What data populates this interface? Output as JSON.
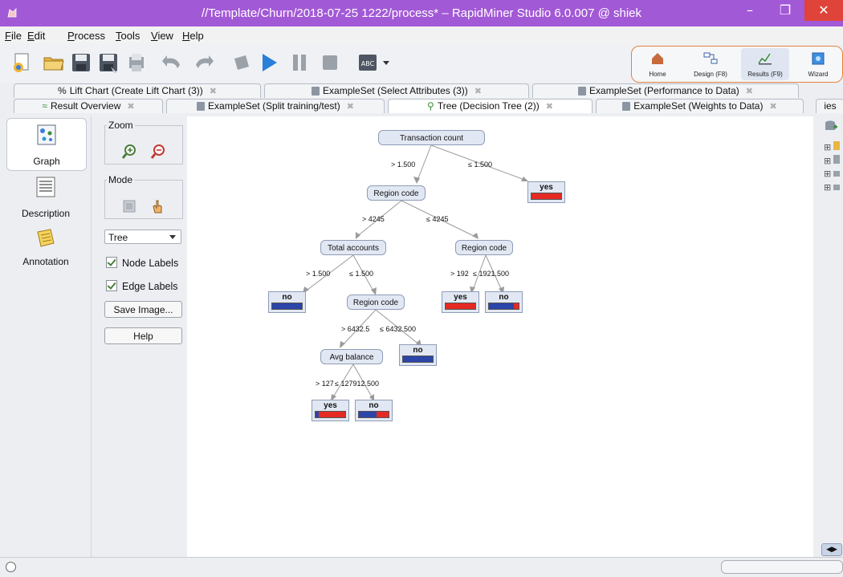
{
  "window": {
    "title": "//Template/Churn/2018-07-25 1222/process* – RapidMiner Studio 6.0.007 @ shiek"
  },
  "menu": [
    {
      "underline": "F",
      "rest": "ile"
    },
    {
      "underline": "E",
      "rest": "dit"
    },
    {
      "underline": "P",
      "rest": "rocess"
    },
    {
      "underline": "T",
      "rest": "ools"
    },
    {
      "underline": "V",
      "rest": "iew"
    },
    {
      "underline": "H",
      "rest": "elp"
    }
  ],
  "perspectives": {
    "home": "Home",
    "design": "Design (F8)",
    "results": "Results (F9)",
    "wizard": "Wizard"
  },
  "tabs_top": [
    {
      "label": "Lift Chart (Create Lift Chart (3))"
    },
    {
      "label": "ExampleSet (Select Attributes (3))"
    },
    {
      "label": "ExampleSet (Performance to Data)"
    }
  ],
  "tabs_bottom": [
    {
      "label": "Result Overview"
    },
    {
      "label": "ExampleSet (Split training/test)"
    },
    {
      "label": "Tree (Decision Tree (2))"
    },
    {
      "label": "ExampleSet (Weights to Data)"
    }
  ],
  "right_tab_label": "ies",
  "views": {
    "graph": "Graph",
    "description": "Description",
    "annotation": "Annotation"
  },
  "tools": {
    "zoom_label": "Zoom",
    "mode_label": "Mode",
    "layout_value": "Tree",
    "node_labels": "Node Labels",
    "edge_labels": "Edge Labels",
    "save_image": "Save Image...",
    "help": "Help"
  },
  "tree": {
    "nodes": {
      "root": "Transaction count",
      "region1": "Region code",
      "total_accounts": "Total accounts",
      "region2": "Region code",
      "region3": "Region code",
      "avg_balance": "Avg balance"
    },
    "edges": {
      "e1": "> 1.500",
      "e2": "≤ 1.500",
      "e3": "> 4245",
      "e4": "≤ 4245",
      "e5": "> 1.500",
      "e6": "≤ 1.500",
      "e7": "> 192",
      "e8": "≤ 1921.500",
      "e9": "> 6432.5",
      "e10": "≤ 6432.500",
      "e11": "> 127",
      "e12": "≤ 127912.500"
    },
    "leaves": [
      {
        "id": "leaf1",
        "label": "yes",
        "red_fraction": 1.0
      },
      {
        "id": "leaf2",
        "label": "no",
        "red_fraction": 0.0
      },
      {
        "id": "leaf3",
        "label": "yes",
        "red_fraction": 1.0
      },
      {
        "id": "leaf4",
        "label": "no",
        "red_fraction": 0.15
      },
      {
        "id": "leaf5",
        "label": "no",
        "red_fraction": 0.0
      },
      {
        "id": "leaf6",
        "label": "yes",
        "red_fraction": 0.9
      },
      {
        "id": "leaf7",
        "label": "no",
        "red_fraction": 0.4
      }
    ]
  },
  "colors": {
    "titlebar": "#a259d6",
    "close": "#e0433a",
    "class_yes": "#e52a23",
    "class_no": "#2b45a8"
  }
}
